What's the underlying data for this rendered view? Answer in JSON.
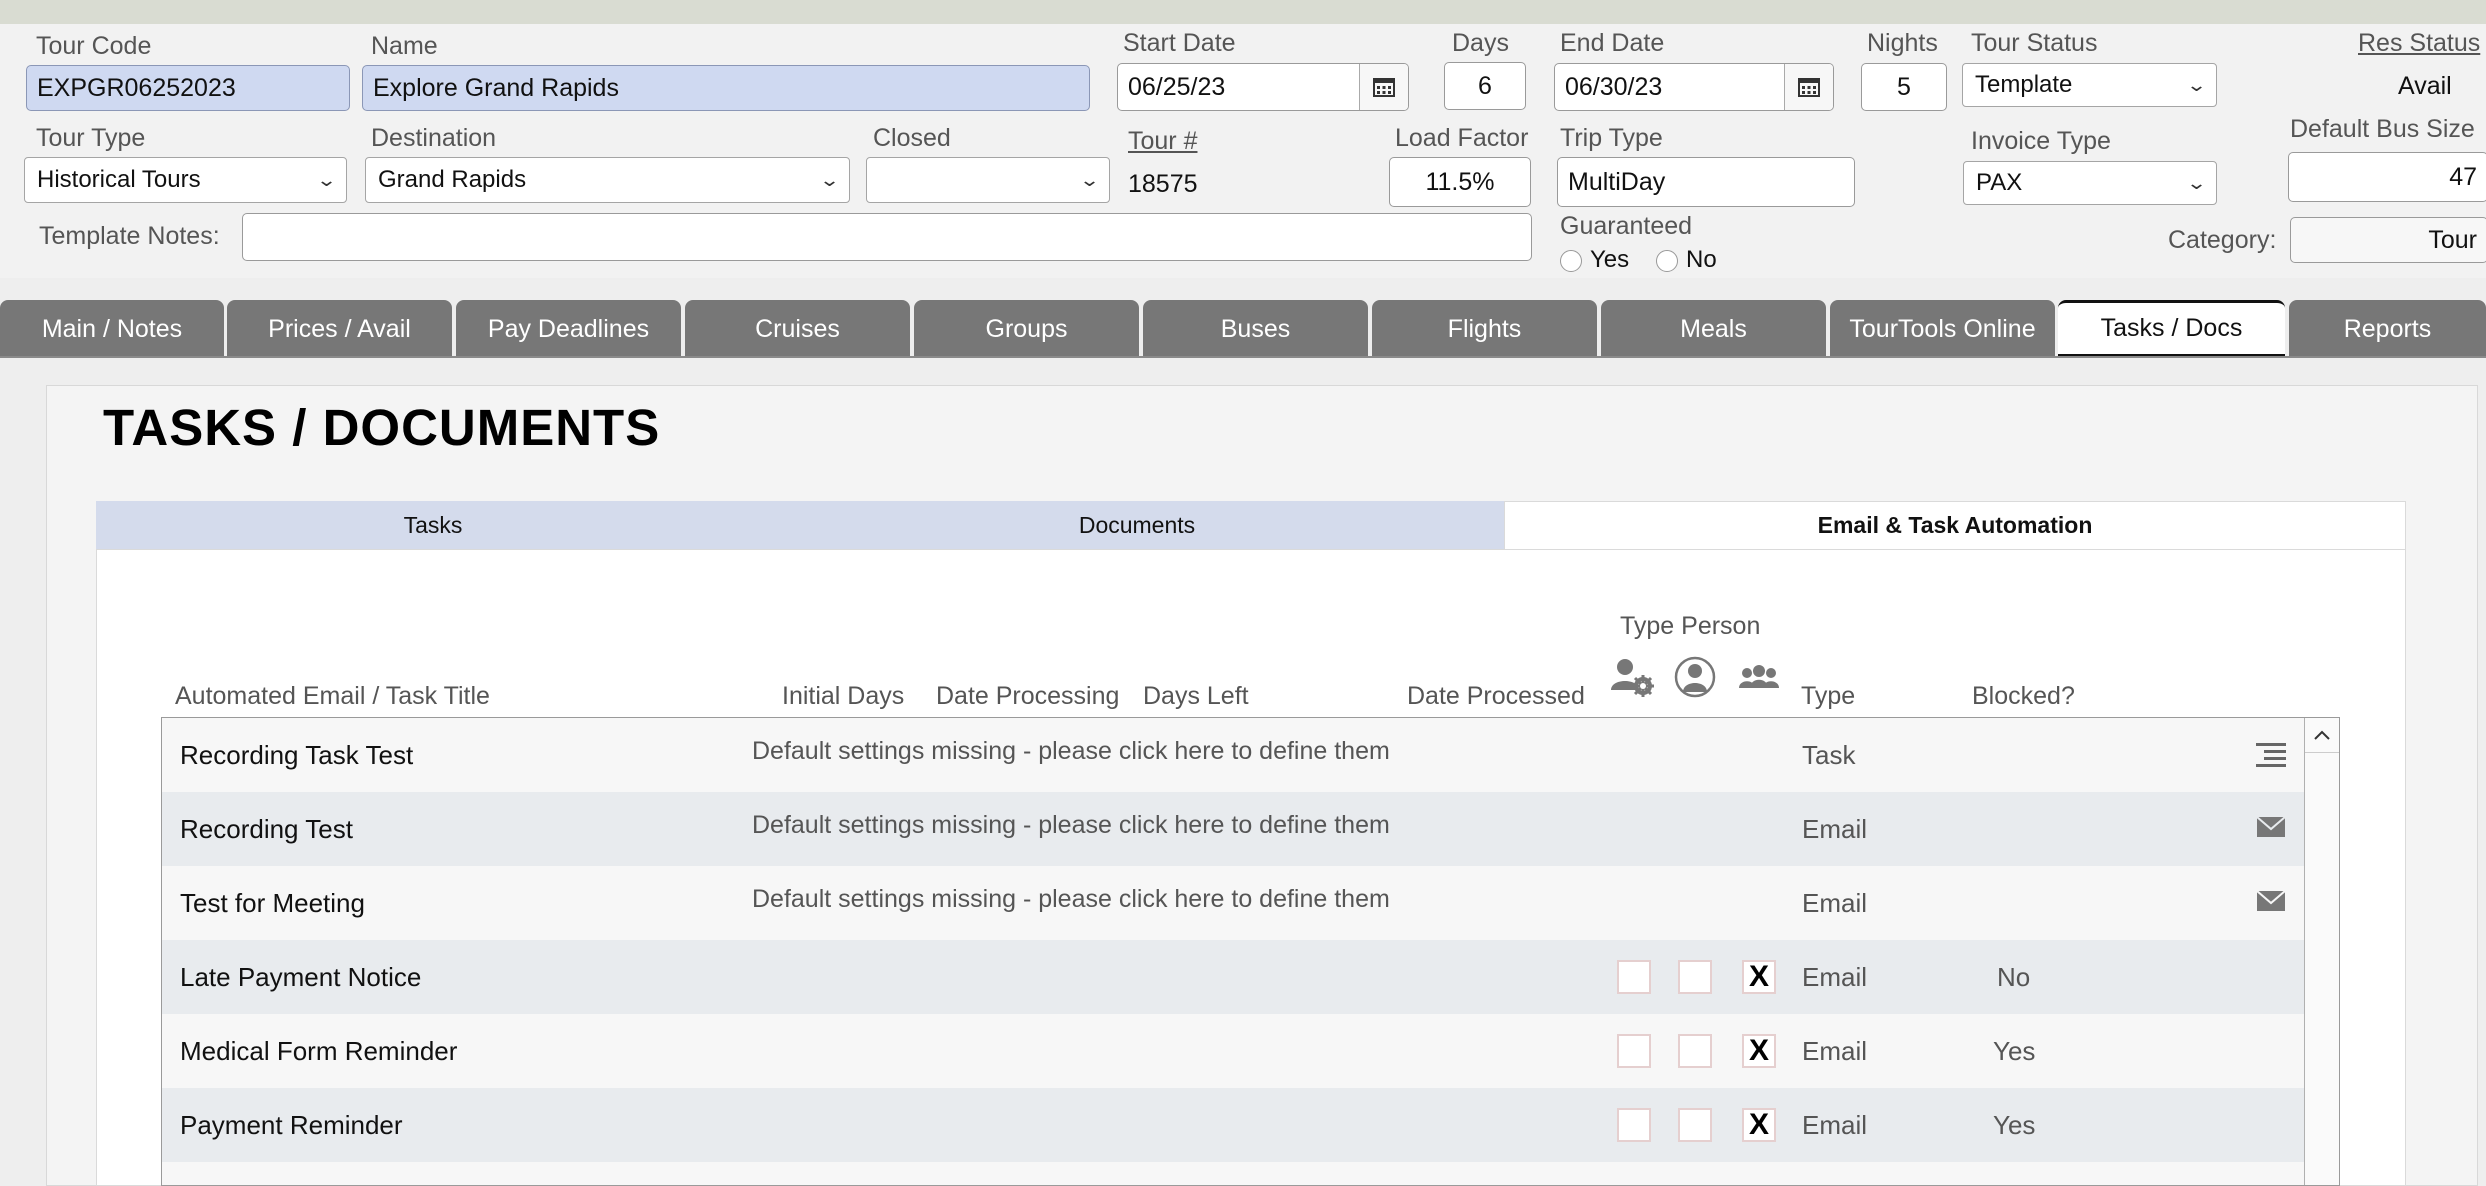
{
  "header": {
    "tour_code": {
      "label": "Tour Code",
      "value": "EXPGR06252023"
    },
    "name": {
      "label": "Name",
      "value": "Explore Grand Rapids"
    },
    "start_date": {
      "label": "Start Date",
      "value": "06/25/23"
    },
    "days": {
      "label": "Days",
      "value": "6"
    },
    "end_date": {
      "label": "End Date",
      "value": "06/30/23"
    },
    "nights": {
      "label": "Nights",
      "value": "5"
    },
    "tour_status": {
      "label": "Tour Status",
      "value": "Template"
    },
    "res_status": {
      "label": "Res Status",
      "value": "Avail"
    },
    "tour_type": {
      "label": "Tour Type",
      "value": "Historical Tours"
    },
    "destination": {
      "label": "Destination",
      "value": "Grand Rapids"
    },
    "closed": {
      "label": "Closed",
      "value": ""
    },
    "tour_number": {
      "label": "Tour #",
      "value": "18575"
    },
    "load_factor": {
      "label": "Load Factor",
      "value": "11.5%"
    },
    "trip_type": {
      "label": "Trip Type",
      "value": "MultiDay"
    },
    "invoice_type": {
      "label": "Invoice Type",
      "value": "PAX"
    },
    "default_bus_size": {
      "label": "Default Bus Size",
      "value": "47"
    },
    "template_notes": {
      "label": "Template Notes:",
      "value": ""
    },
    "guaranteed": {
      "label": "Guaranteed",
      "yes": "Yes",
      "no": "No"
    },
    "category": {
      "label": "Category:",
      "value": "Tour"
    }
  },
  "tabs": [
    {
      "label": "Main / Notes"
    },
    {
      "label": "Prices / Avail"
    },
    {
      "label": "Pay Deadlines"
    },
    {
      "label": "Cruises"
    },
    {
      "label": "Groups"
    },
    {
      "label": "Buses"
    },
    {
      "label": "Flights"
    },
    {
      "label": "Meals"
    },
    {
      "label": "TourTools Online"
    },
    {
      "label": "Tasks / Docs"
    },
    {
      "label": "Reports"
    }
  ],
  "active_tab": "Tasks / Docs",
  "page_title": "TASKS / DOCUMENTS",
  "subtabs": [
    {
      "label": "Tasks"
    },
    {
      "label": "Documents"
    },
    {
      "label": "Email & Task Automation"
    }
  ],
  "active_subtab": "Email & Task Automation",
  "table": {
    "headers": {
      "title": "Automated Email / Task Title",
      "initial_days": "Initial Days",
      "date_processing": "Date Processing",
      "days_left": "Days Left",
      "date_processed": "Date Processed",
      "type_person": "Type Person",
      "type": "Type",
      "blocked": "Blocked?"
    },
    "type_person_icons": [
      "agent-settings-icon",
      "person-icon",
      "group-icon"
    ],
    "rows": [
      {
        "title": "Recording Task Test",
        "note": "Default settings missing - please click here to define them",
        "type": "Task",
        "blocked": "",
        "icon": "task-list-icon"
      },
      {
        "title": "Recording Test",
        "note": "Default settings missing - please click here to define them",
        "type": "Email",
        "blocked": "",
        "icon": "envelope-icon"
      },
      {
        "title": "Test for Meeting",
        "note": "Default settings missing - please click here to define them",
        "type": "Email",
        "blocked": "",
        "icon": "envelope-icon"
      },
      {
        "title": "Late Payment Notice",
        "note": "",
        "type": "Email",
        "blocked": "No",
        "checks": [
          "",
          "",
          "X"
        ]
      },
      {
        "title": "Medical Form Reminder",
        "note": "",
        "type": "Email",
        "blocked": "Yes",
        "checks": [
          "",
          "",
          "X"
        ]
      },
      {
        "title": "Payment Reminder",
        "note": "",
        "type": "Email",
        "blocked": "Yes",
        "checks": [
          "",
          "",
          "X"
        ]
      }
    ]
  }
}
